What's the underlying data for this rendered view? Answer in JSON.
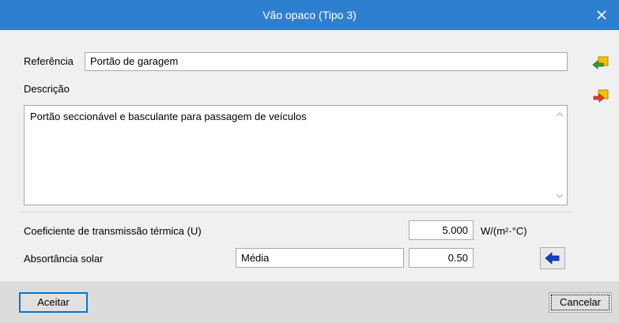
{
  "dialog": {
    "title": "Vão opaco (Tipo 3)"
  },
  "reference": {
    "label": "Referência",
    "value": "Portão de garagem"
  },
  "description": {
    "label": "Descrição",
    "value": "Portão seccionável e basculante para passagem de veículos"
  },
  "thermal": {
    "label": "Coeficiente de transmissão térmica (U)",
    "value": "5.000",
    "unit": "W/(m²·°C)"
  },
  "absorptance": {
    "label": "Absortância solar",
    "class_value": "Média",
    "value": "0.50"
  },
  "footer": {
    "accept_label": "Aceitar",
    "cancel_label": "Cancelar"
  },
  "icons": {
    "import": "import-arrow-icon",
    "export": "export-arrow-icon",
    "select": "blue-left-arrow-icon",
    "close": "close-icon"
  },
  "colors": {
    "titlebar": "#2f7fd1",
    "accent_border": "#0078d7"
  }
}
